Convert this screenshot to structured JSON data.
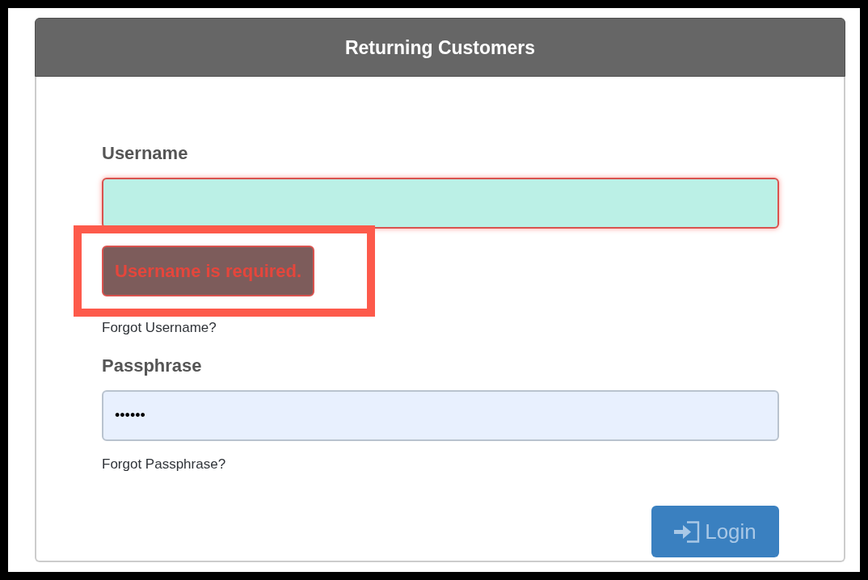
{
  "panel": {
    "title": "Returning Customers"
  },
  "fields": [
    {
      "label": "Username",
      "invalid": true,
      "error": "Username is required.",
      "link": "Forgot Username?"
    },
    {
      "label": "Passphrase",
      "invalid": false,
      "value": "••••••",
      "link": "Forgot Passphrase?"
    }
  ],
  "login_button": {
    "label": "Login",
    "disabled": true
  }
}
